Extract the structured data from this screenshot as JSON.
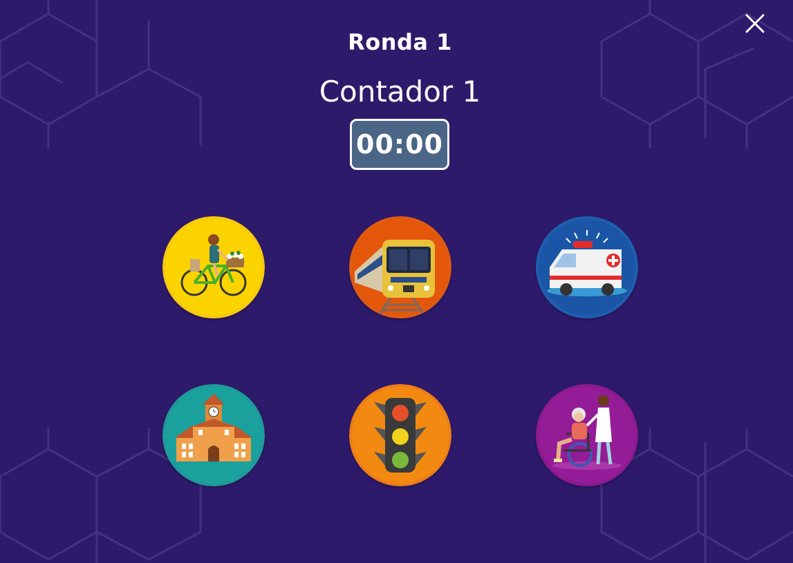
{
  "header": {
    "round_title": "Ronda 1",
    "counter_label": "Contador 1",
    "timer": "00:00"
  },
  "close": {
    "icon": "close-icon"
  },
  "colors": {
    "background": "#2e1a6b",
    "timer_bg": "#4a6586",
    "bike": "#f6c90f",
    "train": "#e05a12",
    "ambulance": "#1f5eb0",
    "school": "#1f9a98",
    "traffic_light": "#ee7d16",
    "caregiver": "#8d1a8f"
  },
  "cards": [
    {
      "icon": "bicycle-woman-icon"
    },
    {
      "icon": "train-icon"
    },
    {
      "icon": "ambulance-icon"
    },
    {
      "icon": "school-building-icon"
    },
    {
      "icon": "traffic-light-icon"
    },
    {
      "icon": "nurse-wheelchair-icon"
    }
  ]
}
